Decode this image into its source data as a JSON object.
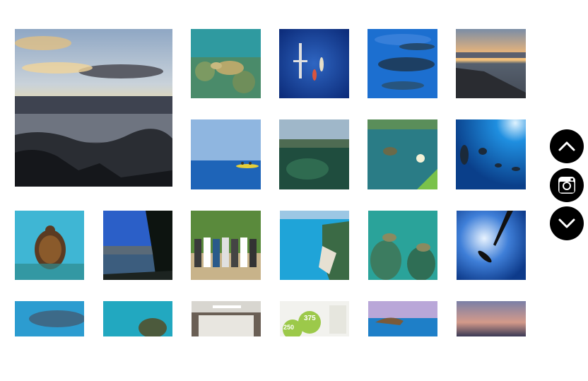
{
  "gallery": {
    "tiles": [
      {
        "icon": "sunset-ocean-rocks-photo"
      },
      {
        "icon": "sea-turtle-reef-photo"
      },
      {
        "icon": "kayaks-aerial-photo"
      },
      {
        "icon": "humpback-whales-photo"
      },
      {
        "icon": "sunset-jetty-photo"
      },
      {
        "icon": "kayakers-horizon-photo"
      },
      {
        "icon": "split-level-reef-photo"
      },
      {
        "icon": "turtle-under-kayak-photo"
      },
      {
        "icon": "snorkelers-dolphins-photo"
      },
      {
        "icon": "turtle-closeup-photo"
      },
      {
        "icon": "beach-palms-photo"
      },
      {
        "icon": "group-photo"
      },
      {
        "icon": "coastline-aerial-photo"
      },
      {
        "icon": "turtles-reef-photo"
      },
      {
        "icon": "freediver-kayak-photo"
      },
      {
        "icon": "whale-underwater-photo"
      },
      {
        "icon": "turtle-face-photo"
      },
      {
        "icon": "meeting-room-photo"
      },
      {
        "icon": "infographic-screen-photo"
      },
      {
        "icon": "crater-coast-photo"
      },
      {
        "icon": "dusk-sky-photo"
      }
    ],
    "infographic_numbers": [
      "250",
      "375"
    ]
  },
  "side_nav": {
    "up_icon": "chevron-up-icon",
    "instagram_icon": "instagram-icon",
    "down_icon": "chevron-down-icon"
  },
  "colors": {
    "button_bg": "#000000",
    "ocean_blue": "#1a6fb0",
    "turquoise": "#3bb3c3"
  }
}
